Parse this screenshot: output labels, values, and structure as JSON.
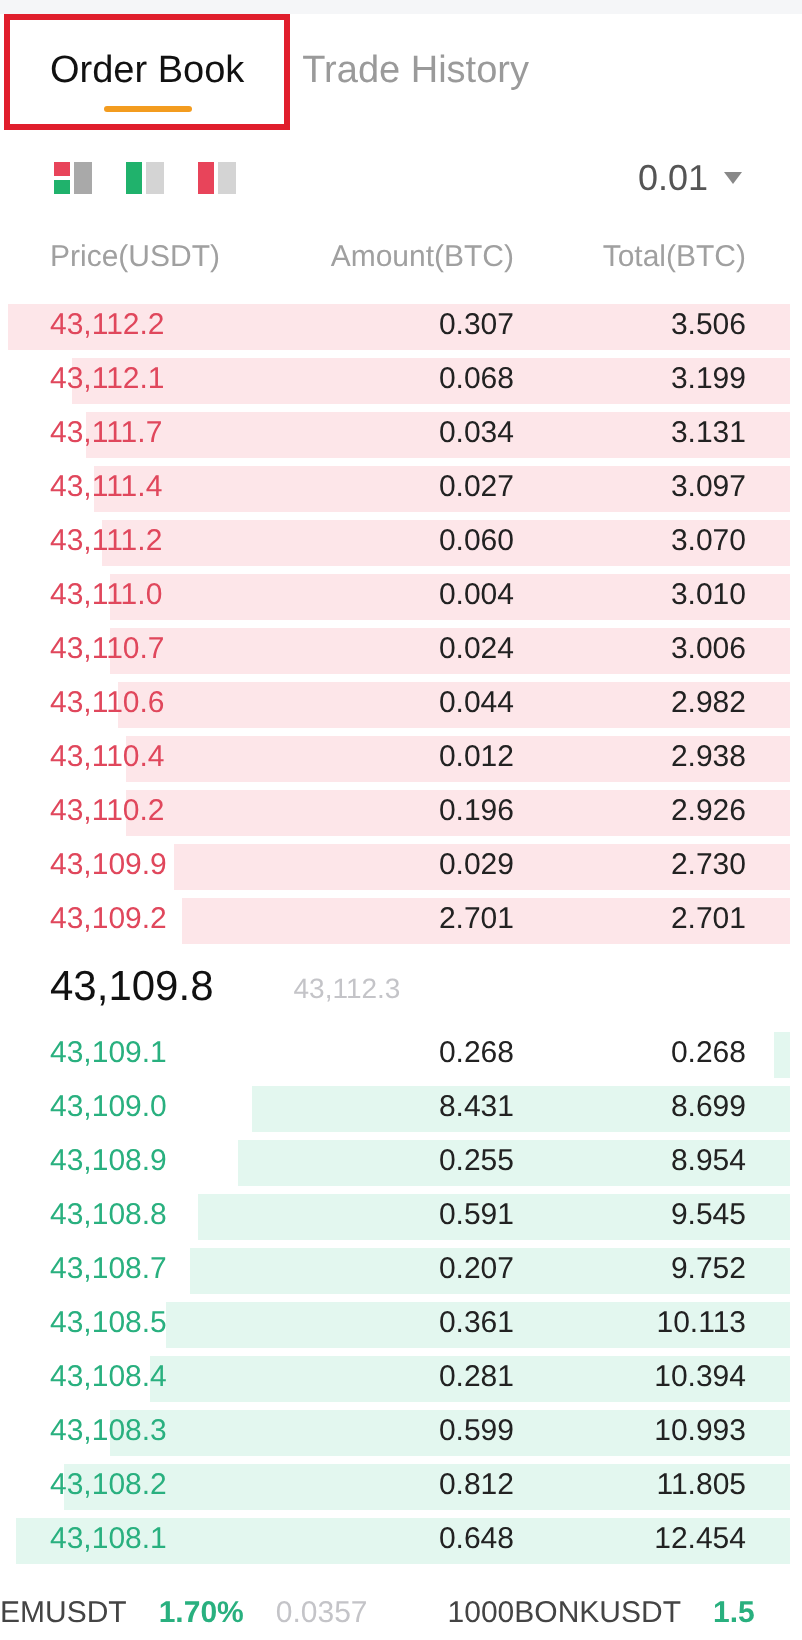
{
  "tabs": [
    {
      "label": "Order Book",
      "selected": true,
      "highlighted": true
    },
    {
      "label": "Trade History",
      "selected": false,
      "highlighted": false
    }
  ],
  "view_modes": [
    {
      "kind": "both"
    },
    {
      "kind": "bids"
    },
    {
      "kind": "asks"
    }
  ],
  "precision": "0.01",
  "columns": [
    "Price(USDT)",
    "Amount(BTC)",
    "Total(BTC)"
  ],
  "asks": [
    {
      "price": "43,112.2",
      "amount": "0.307",
      "total": "3.506"
    },
    {
      "price": "43,112.1",
      "amount": "0.068",
      "total": "3.199"
    },
    {
      "price": "43,111.7",
      "amount": "0.034",
      "total": "3.131"
    },
    {
      "price": "43,111.4",
      "amount": "0.027",
      "total": "3.097"
    },
    {
      "price": "43,111.2",
      "amount": "0.060",
      "total": "3.070"
    },
    {
      "price": "43,111.0",
      "amount": "0.004",
      "total": "3.010"
    },
    {
      "price": "43,110.7",
      "amount": "0.024",
      "total": "3.006"
    },
    {
      "price": "43,110.6",
      "amount": "0.044",
      "total": "2.982"
    },
    {
      "price": "43,110.4",
      "amount": "0.012",
      "total": "2.938"
    },
    {
      "price": "43,110.2",
      "amount": "0.196",
      "total": "2.926"
    },
    {
      "price": "43,109.9",
      "amount": "0.029",
      "total": "2.730"
    },
    {
      "price": "43,109.2",
      "amount": "2.701",
      "total": "2.701"
    }
  ],
  "last_price": "43,109.8",
  "mark_price": "43,112.3",
  "bids": [
    {
      "price": "43,109.1",
      "amount": "0.268",
      "total": "0.268"
    },
    {
      "price": "43,109.0",
      "amount": "8.431",
      "total": "8.699"
    },
    {
      "price": "43,108.9",
      "amount": "0.255",
      "total": "8.954"
    },
    {
      "price": "43,108.8",
      "amount": "0.591",
      "total": "9.545"
    },
    {
      "price": "43,108.7",
      "amount": "0.207",
      "total": "9.752"
    },
    {
      "price": "43,108.5",
      "amount": "0.361",
      "total": "10.113"
    },
    {
      "price": "43,108.4",
      "amount": "0.281",
      "total": "10.394"
    },
    {
      "price": "43,108.3",
      "amount": "0.599",
      "total": "10.993"
    },
    {
      "price": "43,108.2",
      "amount": "0.812",
      "total": "11.805"
    },
    {
      "price": "43,108.1",
      "amount": "0.648",
      "total": "12.454"
    }
  ],
  "ticker": [
    {
      "symbol": "EMUSDT",
      "change": "1.70%",
      "price": "0.0357"
    },
    {
      "symbol": "1000BONKUSDT",
      "change": "1.5"
    }
  ]
}
